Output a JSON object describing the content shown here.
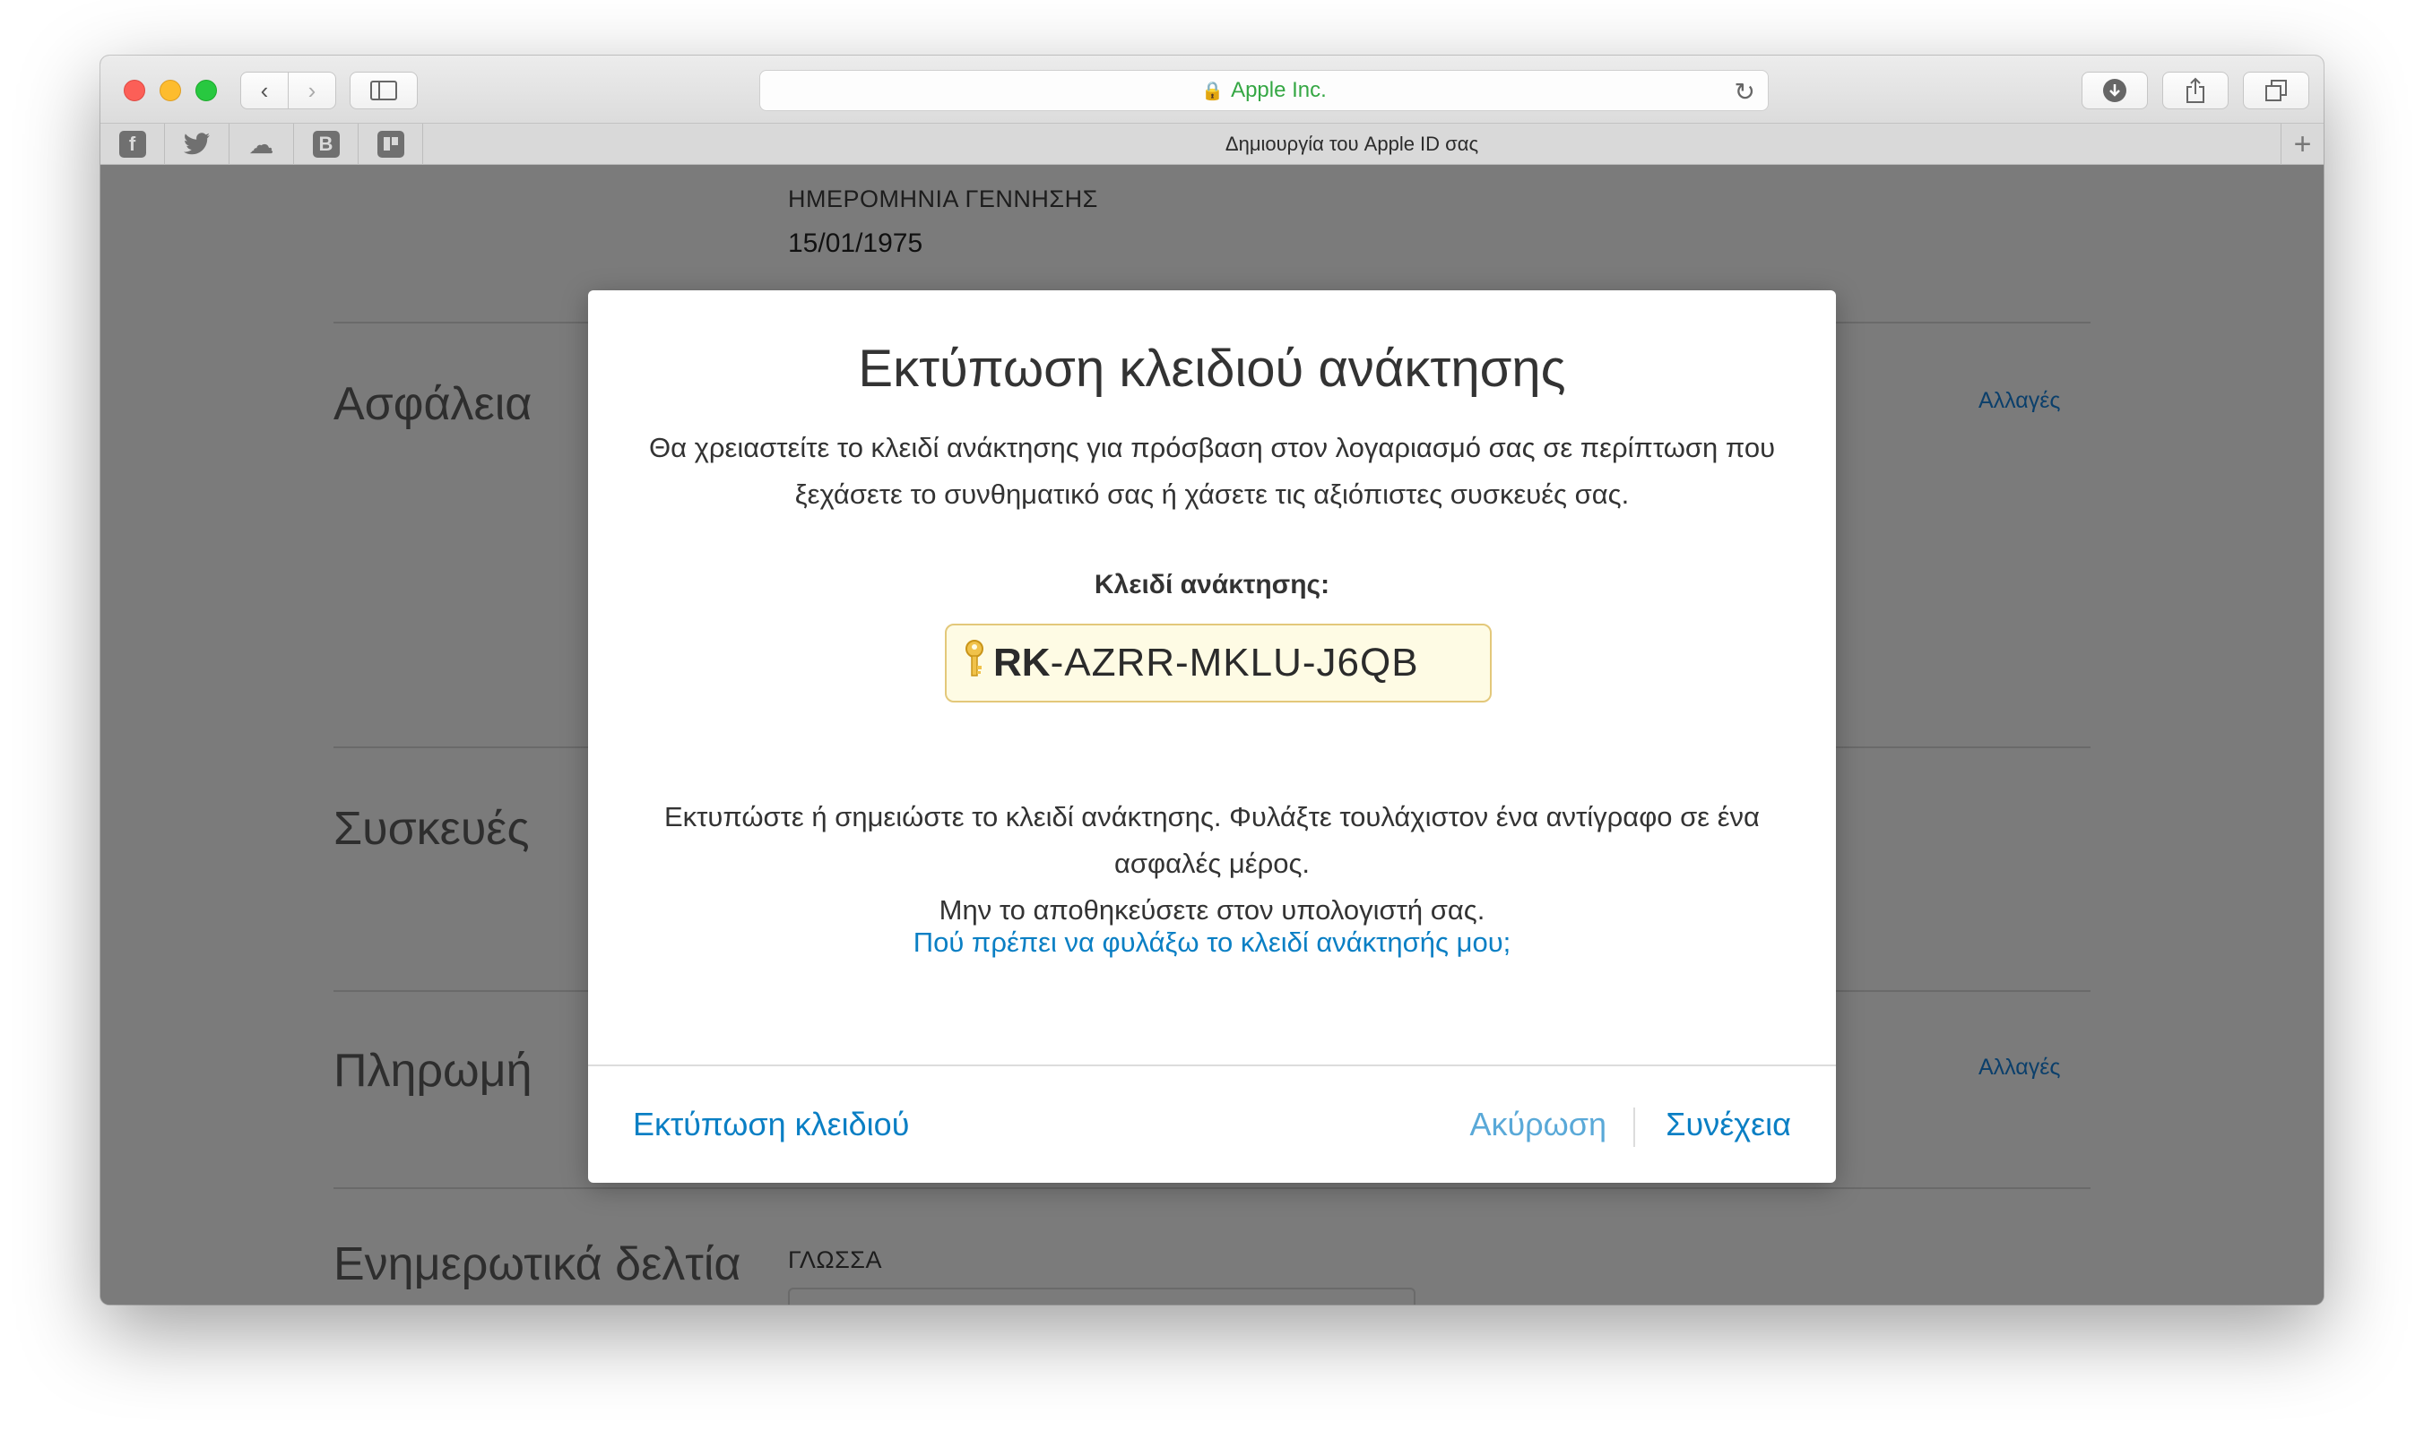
{
  "browser": {
    "address": "Apple Inc.",
    "tab_title": "Δημιουργία του Apple ID σας",
    "favorites": [
      {
        "name": "facebook-icon",
        "glyph": "f"
      },
      {
        "name": "twitter-icon",
        "glyph": "🐦"
      },
      {
        "name": "cloud-icon",
        "glyph": "☁"
      },
      {
        "name": "vk-icon",
        "glyph": "B"
      },
      {
        "name": "trello-icon",
        "glyph": "▦"
      }
    ]
  },
  "page": {
    "birthdate_label": "ΗΜΕΡΟΜΗΝΙΑ ΓΕΝΝΗΣΗΣ",
    "birthdate_value": "15/01/1975",
    "sections": {
      "security": "Ασφάλεια",
      "devices": "Συσκευές",
      "payment": "Πληρωμή",
      "newsletters": "Ενημερωτικά δελτία"
    },
    "changes_label": "Αλλαγές",
    "language_label": "ΓΛΩΣΣΑ"
  },
  "modal": {
    "title": "Εκτύπωση κλειδιού ανάκτησης",
    "intro": "Θα χρειαστείτε το κλειδί ανάκτησης για πρόσβαση στον λογαριασμό σας σε περίπτωση που ξεχάσετε το συνθηματικό σας ή χάσετε τις αξιόπιστες συσκευές σας.",
    "key_label": "Κλειδί ανάκτησης:",
    "key_prefix": "RK",
    "key_rest": "-AZRR-MKLU-J6QB",
    "instructions_1": "Εκτυπώστε ή σημειώστε το κλειδί ανάκτησης. Φυλάξτε τουλάχιστον ένα αντίγραφο σε ένα ασφαλές μέρος.",
    "instructions_2": "Μην το αποθηκεύσετε στον υπολογιστή σας.",
    "help_link": "Πού πρέπει να φυλάξω το κλειδί ανάκτησής μου;",
    "print_button": "Εκτύπωση κλειδιού",
    "cancel_button": "Ακύρωση",
    "continue_button": "Συνέχεια"
  }
}
